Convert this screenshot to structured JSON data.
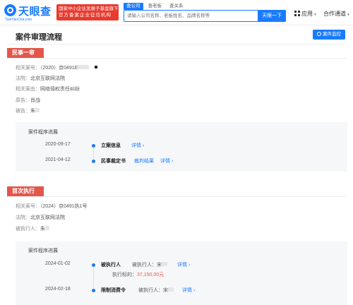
{
  "header": {
    "logo_cn": "天眼查",
    "logo_en": "TianYanCha.com",
    "gov_badge_line1": "国家中小企业发展子基金旗下",
    "gov_badge_line2": "官方备案企业征信机构",
    "search_tabs": [
      "查公司",
      "查老板",
      "查关系"
    ],
    "search_placeholder": "请输入公司名称、老板姓名、品牌名称等",
    "search_button": "天眼一下",
    "apps_label": "应用",
    "coop_label": "合作通道"
  },
  "page": {
    "title": "案件审理流程",
    "monitor_button": "案件监控"
  },
  "first_trial": {
    "tag": "民事一审",
    "case_no_label": "相关案号：",
    "case_no": "（2020）京0491E",
    "court_label": "法院：",
    "court": "北京互联网法院",
    "cause_label": "相关案由：",
    "cause": "网络侵权责任纠纷",
    "plaintiff_label": "原告：",
    "plaintiff": "肖战",
    "defendant_label": "被告：",
    "defendant": "朱",
    "process_title": "案件程序进展",
    "timeline": [
      {
        "date": "2020-09-17",
        "event": "立案信息",
        "extra": "",
        "link": "详情 ›"
      },
      {
        "date": "2021-04-12",
        "event": "民事裁定书",
        "extra": "裁判结果",
        "link": "详情 ›"
      }
    ]
  },
  "execution": {
    "tag": "首次执行",
    "case_no_label": "相关案号：",
    "case_no": "（2024）京0491执1号",
    "court_label": "法院：",
    "court": "北京互联网法院",
    "executed_label": "被执行人：",
    "executed": "朱",
    "process_title": "案件程序进展",
    "timeline": [
      {
        "date": "2024-01-02",
        "event": "被执行人",
        "party_label": "被执行人：",
        "party": "宋",
        "link": "详情 ›",
        "amount_label": "执行标的：",
        "amount": "37,150.00元"
      },
      {
        "date": "2024-02-18",
        "event": "限制消费令",
        "party_label": "被执行人：",
        "party": "宋",
        "link": "详情 ›"
      }
    ]
  },
  "colors": {
    "brand_blue": "#1a7bff",
    "tag_red": "#e2574c",
    "gov_red": "#e83a2e"
  }
}
